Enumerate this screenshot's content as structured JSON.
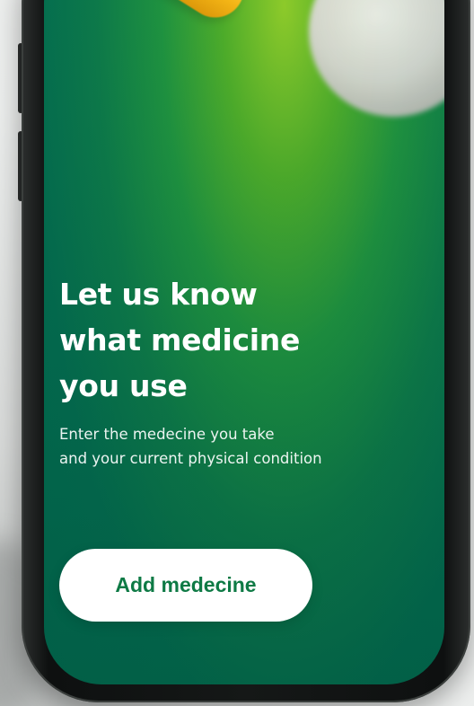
{
  "onboarding": {
    "headline_lines": [
      "Let us know",
      "what medicine",
      "you use"
    ],
    "subtext_lines": [
      "Enter the medecine you take",
      "and your current physical condition"
    ],
    "cta_label": "Add medecine"
  },
  "colors": {
    "accent_green": "#0e7a45",
    "screen_dark": "#016a50",
    "screen_light": "#8fcc2a",
    "capsule": "#f7b716",
    "button_bg": "#ffffff"
  }
}
